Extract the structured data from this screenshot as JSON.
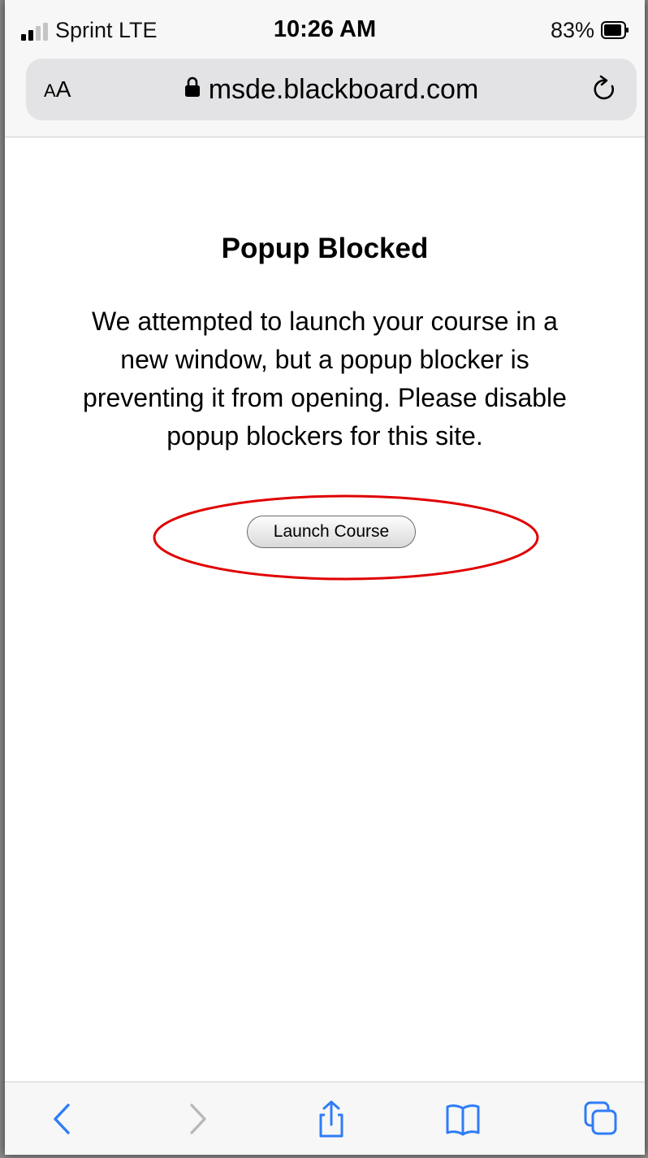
{
  "status_bar": {
    "carrier": "Sprint  LTE",
    "time": "10:26 AM",
    "battery_percent": "83%"
  },
  "address_bar": {
    "text_size_label": "AA",
    "url": "msde.blackboard.com",
    "icons": [
      "lock-icon",
      "reload-icon"
    ]
  },
  "page": {
    "title": "Popup Blocked",
    "message": "We attempted to launch your course in a new window, but a popup blocker is preventing it from opening. Please disable popup blockers for this site.",
    "launch_button": "Launch Course"
  },
  "annotation": {
    "shape": "ellipse",
    "color": "#e00000"
  },
  "bottom_toolbar": {
    "icons": [
      "back-icon",
      "forward-icon",
      "share-icon",
      "bookmarks-icon",
      "tabs-icon"
    ],
    "accent": "#2f7cf6",
    "disabled": "#b8b8bc"
  }
}
